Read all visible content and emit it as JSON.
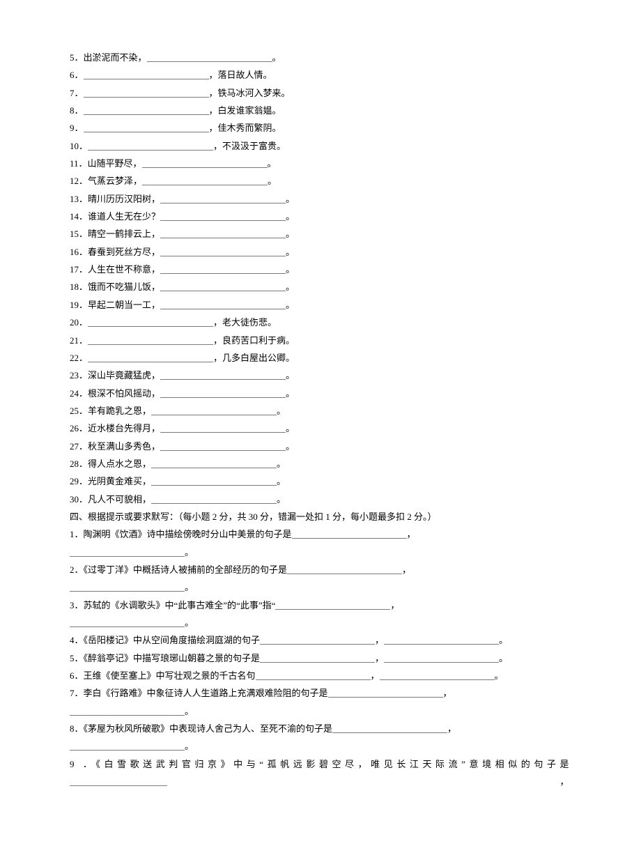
{
  "fill": {
    "items": [
      {
        "num": "5．",
        "pre": "出淤泥而不染，",
        "post": "。",
        "preBlank": false
      },
      {
        "num": "6．",
        "pre": "",
        "post": "，落日故人情。",
        "preBlank": true
      },
      {
        "num": "7．",
        "pre": "",
        "post": "，铁马冰河入梦来。",
        "preBlank": true
      },
      {
        "num": "8．",
        "pre": "",
        "post": "，白发谁家翁媪。",
        "preBlank": true
      },
      {
        "num": "9．",
        "pre": "",
        "post": "，佳木秀而繁阴。",
        "preBlank": true
      },
      {
        "num": "10．",
        "pre": "",
        "post": "，不汲汲于富贵。",
        "preBlank": true
      },
      {
        "num": "11．",
        "pre": "山随平野尽，",
        "post": "。",
        "preBlank": false
      },
      {
        "num": "12．",
        "pre": "气蒸云梦泽，",
        "post": "。",
        "preBlank": false
      },
      {
        "num": "13．",
        "pre": "晴川历历汉阳树，",
        "post": "。",
        "preBlank": false
      },
      {
        "num": "14．",
        "pre": "谁道人生无在少？",
        "post": "。",
        "preBlank": false
      },
      {
        "num": "15．",
        "pre": "晴空一鹤排云上，",
        "post": "。",
        "preBlank": false
      },
      {
        "num": "16．",
        "pre": "春蚕到死丝方尽，",
        "post": "。",
        "preBlank": false
      },
      {
        "num": "17．",
        "pre": "人生在世不称意，",
        "post": "。",
        "preBlank": false
      },
      {
        "num": "18．",
        "pre": "饿而不吃猫儿饭，",
        "post": "。",
        "preBlank": false
      },
      {
        "num": "19．",
        "pre": "早起二朝当一工，",
        "post": "。",
        "preBlank": false
      },
      {
        "num": "20．",
        "pre": "",
        "post": "，老大徒伤悲。",
        "preBlank": true
      },
      {
        "num": "21．",
        "pre": "",
        "post": "，良药苦口利于病。",
        "preBlank": true
      },
      {
        "num": "22．",
        "pre": "",
        "post": "，几多白屋出公卿。",
        "preBlank": true
      },
      {
        "num": "23．",
        "pre": "深山毕竟藏猛虎，",
        "post": "。",
        "preBlank": false
      },
      {
        "num": "24．",
        "pre": "根深不怕风摇动，",
        "post": "。",
        "preBlank": false
      },
      {
        "num": "25．",
        "pre": "羊有跪乳之恩，",
        "post": "。",
        "preBlank": false
      },
      {
        "num": "26．",
        "pre": "近水楼台先得月，",
        "post": "。",
        "preBlank": false
      },
      {
        "num": "27．",
        "pre": "秋至满山多秀色，",
        "post": "。",
        "preBlank": false
      },
      {
        "num": "28．",
        "pre": "得人点水之恩，",
        "post": "。",
        "preBlank": false
      },
      {
        "num": "29．",
        "pre": "光阴黄金难买，",
        "post": "。",
        "preBlank": false
      },
      {
        "num": "30．",
        "pre": "凡人不可貌相，",
        "post": "。",
        "preBlank": false
      }
    ]
  },
  "section4": {
    "heading": "四、根据提示或要求默写：（每小题 2 分，共 30 分，错漏一处扣 1 分，每小题最多扣 2 分。）",
    "q": [
      {
        "num": "1．",
        "text": "陶渊明《饮酒》诗中描绘傍晚时分山中美景的句子是",
        "twoBlanks": true,
        "twoLine": true
      },
      {
        "num": "2．",
        "text": "《过零丁洋》中概括诗人被捕前的全部经历的句子是",
        "twoBlanks": true,
        "twoLine": true
      },
      {
        "num": "3．",
        "text": "苏轼的《水调歌头》中“此事古难全”的“此事”指“",
        "twoBlanks": true,
        "twoLine": true
      },
      {
        "num": "4．",
        "text": "《岳阳楼记》中从空间角度描绘洞庭湖的句子",
        "twoBlanks": true,
        "twoLine": false
      },
      {
        "num": "5．",
        "text": "《醉翁亭记》中描写琅琊山朝暮之景的句子是",
        "twoBlanks": true,
        "twoLine": false
      },
      {
        "num": "6．",
        "text": "王维《使至塞上》中写壮观之景的千古名句",
        "twoBlanks": true,
        "twoLine": false
      },
      {
        "num": "7．",
        "text": "李白《行路难》中象征诗人人生道路上充满艰难险阻的句子是",
        "twoBlanks": true,
        "twoLine": true
      },
      {
        "num": "8．",
        "text": "《茅屋为秋风所破歌》中表现诗人舍己为人、至死不渝的句子是",
        "twoBlanks": true,
        "twoLine": true
      }
    ],
    "q9_num": "9 ．",
    "q9_text": "《白雪歌送武判官归京》中与“孤帆远影碧空尽，唯见长江天际流”意境相似的句子是",
    "q9_tail": "，"
  }
}
